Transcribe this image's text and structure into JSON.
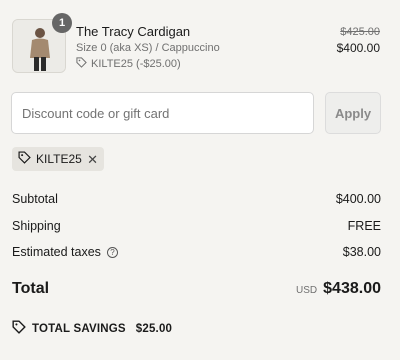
{
  "item": {
    "quantity": "1",
    "title": "The Tracy Cardigan",
    "variant": "Size 0 (aka XS) / Cappuccino",
    "discount": "KILTE25 (-$25.00)",
    "original_price": "$425.00",
    "price": "$400.00"
  },
  "discount_form": {
    "placeholder": "Discount code or gift card",
    "apply_label": "Apply"
  },
  "applied_code": {
    "code": "KILTE25"
  },
  "summary": {
    "subtotal_label": "Subtotal",
    "subtotal_value": "$400.00",
    "shipping_label": "Shipping",
    "shipping_value": "FREE",
    "taxes_label": "Estimated taxes",
    "taxes_value": "$38.00",
    "total_label": "Total",
    "currency": "USD",
    "total_value": "$438.00",
    "savings_label": "TOTAL SAVINGS",
    "savings_value": "$25.00"
  }
}
